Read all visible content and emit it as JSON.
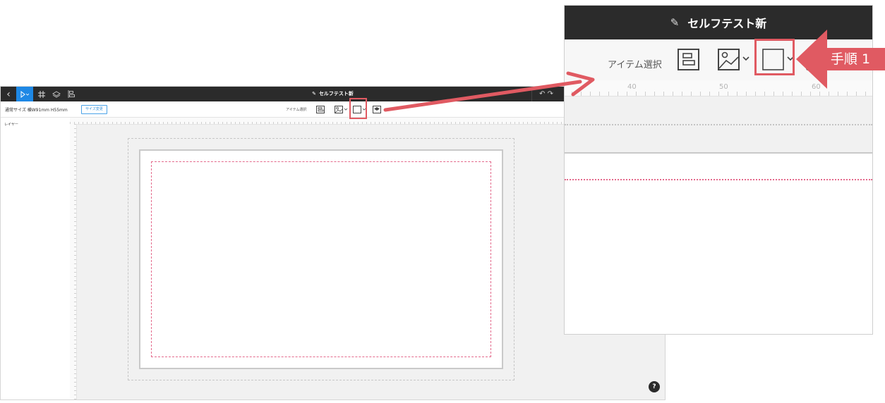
{
  "app": {
    "title": "セルフテスト新",
    "size_label": "通常サイズ 横W91mm H55mm",
    "size_change_button": "サイズ変更",
    "item_select_label": "アイテム選択",
    "layer_label": "レイヤー",
    "help": "?"
  },
  "zoom": {
    "ruler_ticks": [
      "40",
      "50",
      "60"
    ]
  },
  "annotation": {
    "step_label": "手順 1",
    "accent_color": "#e05a62"
  },
  "colors": {
    "topbar": "#2b2b2b",
    "select_tool": "#1e88e5",
    "safe_line": "#e46a8c"
  },
  "icons": {
    "back": "chevron-left-icon",
    "select": "pointer-icon",
    "grid": "grid-icon",
    "layers": "layers-icon",
    "align": "align-icon",
    "pencil": "pencil-icon",
    "frame": "frame-tool-icon",
    "image": "image-tool-icon",
    "shape": "square-shape-icon",
    "background": "background-tool-icon"
  }
}
